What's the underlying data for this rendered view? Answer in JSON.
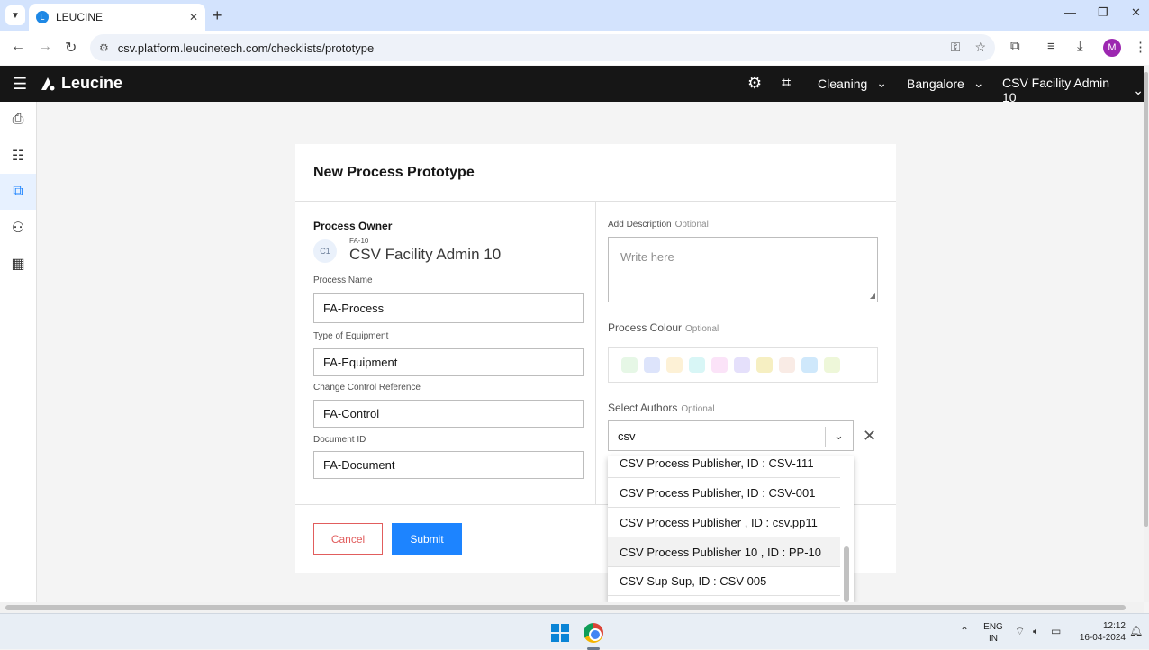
{
  "browser": {
    "tab_title": "LEUCINE",
    "url": "csv.platform.leucinetech.com/checklists/prototype",
    "profile_initial": "M"
  },
  "appbar": {
    "brand": "Leucine",
    "facility_menu": "Cleaning",
    "location_menu": "Bangalore",
    "user_menu": "CSV Facility Admin 10"
  },
  "form": {
    "title": "New Process Prototype",
    "process_owner_label": "Process Owner",
    "owner_avatar": "C1",
    "owner_id": "FA-10",
    "owner_name": "CSV Facility Admin 10",
    "process_name_label": "Process Name",
    "process_name_value": "FA-Process",
    "equipment_label": "Type of Equipment",
    "equipment_value": "FA-Equipment",
    "change_control_label": "Change Control Reference",
    "change_control_value": "FA-Control",
    "document_id_label": "Document ID",
    "document_id_value": "FA-Document",
    "description_label": "Add Description",
    "description_placeholder": "Write here",
    "colour_label": "Process Colour",
    "authors_label": "Select Authors",
    "optional_text": "Optional",
    "authors_search_value": "csv",
    "swatch_colors": [
      "#e6f7e6",
      "#dde4fb",
      "#fdf1d6",
      "#d8f6f6",
      "#fbe3f8",
      "#e5e0fb",
      "#f6efc2",
      "#f9ebe5",
      "#cfe8fb",
      "#eef7d9"
    ],
    "cancel_label": "Cancel",
    "submit_label": "Submit"
  },
  "authors_dropdown": {
    "options": [
      "CSV Process Publisher, ID : CSV-111",
      "CSV Process Publisher, ID : CSV-001",
      "CSV Process Publisher , ID : csv.pp11",
      "CSV Process Publisher 10 , ID : PP-10",
      "CSV Sup Sup, ID : CSV-005"
    ]
  },
  "taskbar": {
    "lang_top": "ENG",
    "lang_bottom": "IN",
    "time": "12:12",
    "date": "16-04-2024"
  },
  "colors": {
    "accent": "#1d84ff",
    "cancel": "#e15d5d",
    "appbar_bg": "#161616"
  }
}
